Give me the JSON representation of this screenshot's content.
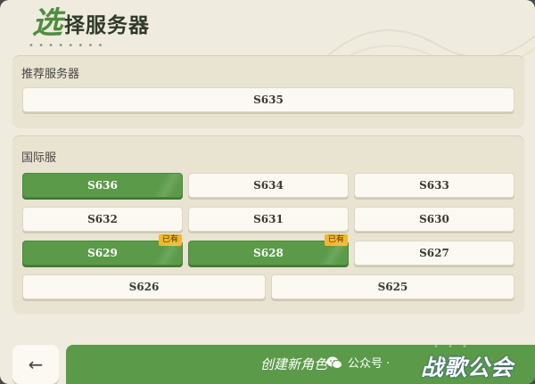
{
  "title": {
    "first": "选",
    "rest": "择服务器"
  },
  "recommended": {
    "label": "推荐服务器",
    "server": "S635"
  },
  "international": {
    "label": "国际服",
    "servers": [
      {
        "name": "S636",
        "active": true,
        "badge": ""
      },
      {
        "name": "S634",
        "active": false,
        "badge": ""
      },
      {
        "name": "S633",
        "active": false,
        "badge": ""
      },
      {
        "name": "S632",
        "active": false,
        "badge": ""
      },
      {
        "name": "S631",
        "active": false,
        "badge": ""
      },
      {
        "name": "S630",
        "active": false,
        "badge": ""
      },
      {
        "name": "S629",
        "active": true,
        "badge": "已有"
      },
      {
        "name": "S628",
        "active": true,
        "badge": "已有"
      },
      {
        "name": "S627",
        "active": false,
        "badge": ""
      },
      {
        "name": "S626",
        "active": false,
        "badge": ""
      },
      {
        "name": "S625",
        "active": false,
        "badge": ""
      }
    ]
  },
  "footer": {
    "back_icon": "back-arrow-icon",
    "create_label": "创建新角色"
  },
  "watermark": {
    "wechat": "公众号 · ",
    "guild": "战歌公会"
  },
  "colors": {
    "accent": "#5a9a48",
    "badge": "#f0b731",
    "panel": "#efebde"
  }
}
